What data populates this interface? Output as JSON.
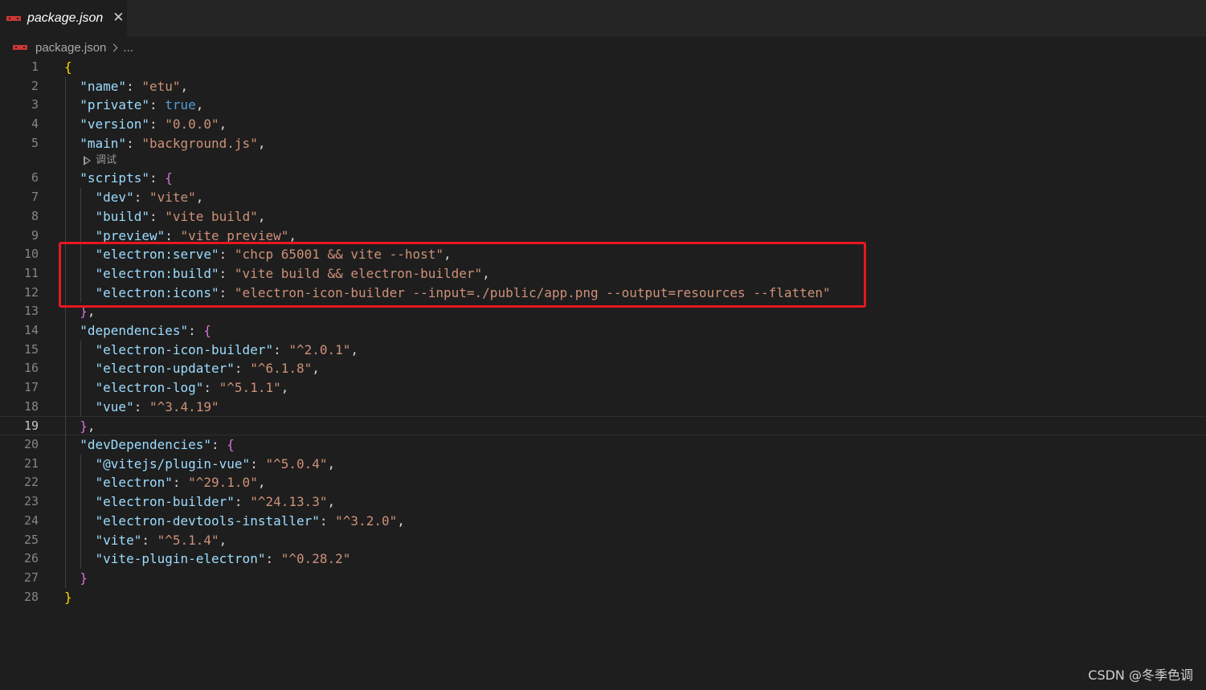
{
  "tab": {
    "title": "package.json",
    "close_glyph": "✕",
    "icon": "npm-icon"
  },
  "breadcrumb": {
    "file": "package.json",
    "more": "..."
  },
  "codelens": {
    "label": "调试",
    "icon": "play-icon"
  },
  "current_line": 19,
  "lines": [
    {
      "n": "1",
      "tokens": [
        [
          "y",
          "{"
        ]
      ]
    },
    {
      "n": "2",
      "tokens": [
        [
          "p",
          "  "
        ],
        [
          "k",
          "\"name\""
        ],
        [
          "p",
          ": "
        ],
        [
          "s",
          "\"etu\""
        ],
        [
          "p",
          ","
        ]
      ]
    },
    {
      "n": "3",
      "tokens": [
        [
          "p",
          "  "
        ],
        [
          "k",
          "\"private\""
        ],
        [
          "p",
          ": "
        ],
        [
          "b",
          "true"
        ],
        [
          "p",
          ","
        ]
      ]
    },
    {
      "n": "4",
      "tokens": [
        [
          "p",
          "  "
        ],
        [
          "k",
          "\"version\""
        ],
        [
          "p",
          ": "
        ],
        [
          "s",
          "\"0.0.0\""
        ],
        [
          "p",
          ","
        ]
      ]
    },
    {
      "n": "5",
      "tokens": [
        [
          "p",
          "  "
        ],
        [
          "k",
          "\"main\""
        ],
        [
          "p",
          ": "
        ],
        [
          "s",
          "\"background.js\""
        ],
        [
          "p",
          ","
        ]
      ]
    },
    {
      "n": "6",
      "tokens": [
        [
          "p",
          "  "
        ],
        [
          "k",
          "\"scripts\""
        ],
        [
          "p",
          ": "
        ],
        [
          "m",
          "{"
        ]
      ]
    },
    {
      "n": "7",
      "tokens": [
        [
          "p",
          "    "
        ],
        [
          "k",
          "\"dev\""
        ],
        [
          "p",
          ": "
        ],
        [
          "s",
          "\"vite\""
        ],
        [
          "p",
          ","
        ]
      ]
    },
    {
      "n": "8",
      "tokens": [
        [
          "p",
          "    "
        ],
        [
          "k",
          "\"build\""
        ],
        [
          "p",
          ": "
        ],
        [
          "s",
          "\"vite build\""
        ],
        [
          "p",
          ","
        ]
      ]
    },
    {
      "n": "9",
      "tokens": [
        [
          "p",
          "    "
        ],
        [
          "k",
          "\"preview\""
        ],
        [
          "p",
          ": "
        ],
        [
          "s",
          "\"vite preview\""
        ],
        [
          "p",
          ","
        ]
      ]
    },
    {
      "n": "10",
      "tokens": [
        [
          "p",
          "    "
        ],
        [
          "k",
          "\"electron:serve\""
        ],
        [
          "p",
          ": "
        ],
        [
          "s",
          "\"chcp 65001 && vite --host\""
        ],
        [
          "p",
          ","
        ]
      ]
    },
    {
      "n": "11",
      "tokens": [
        [
          "p",
          "    "
        ],
        [
          "k",
          "\"electron:build\""
        ],
        [
          "p",
          ": "
        ],
        [
          "s",
          "\"vite build && electron-builder\""
        ],
        [
          "p",
          ","
        ]
      ]
    },
    {
      "n": "12",
      "tokens": [
        [
          "p",
          "    "
        ],
        [
          "k",
          "\"electron:icons\""
        ],
        [
          "p",
          ": "
        ],
        [
          "s",
          "\"electron-icon-builder --input=./public/app.png --output=resources --flatten\""
        ]
      ]
    },
    {
      "n": "13",
      "tokens": [
        [
          "p",
          "  "
        ],
        [
          "m",
          "}"
        ],
        [
          "p",
          ","
        ]
      ]
    },
    {
      "n": "14",
      "tokens": [
        [
          "p",
          "  "
        ],
        [
          "k",
          "\"dependencies\""
        ],
        [
          "p",
          ": "
        ],
        [
          "m",
          "{"
        ]
      ]
    },
    {
      "n": "15",
      "tokens": [
        [
          "p",
          "    "
        ],
        [
          "k",
          "\"electron-icon-builder\""
        ],
        [
          "p",
          ": "
        ],
        [
          "s",
          "\"^2.0.1\""
        ],
        [
          "p",
          ","
        ]
      ]
    },
    {
      "n": "16",
      "tokens": [
        [
          "p",
          "    "
        ],
        [
          "k",
          "\"electron-updater\""
        ],
        [
          "p",
          ": "
        ],
        [
          "s",
          "\"^6.1.8\""
        ],
        [
          "p",
          ","
        ]
      ]
    },
    {
      "n": "17",
      "tokens": [
        [
          "p",
          "    "
        ],
        [
          "k",
          "\"electron-log\""
        ],
        [
          "p",
          ": "
        ],
        [
          "s",
          "\"^5.1.1\""
        ],
        [
          "p",
          ","
        ]
      ]
    },
    {
      "n": "18",
      "tokens": [
        [
          "p",
          "    "
        ],
        [
          "k",
          "\"vue\""
        ],
        [
          "p",
          ": "
        ],
        [
          "s",
          "\"^3.4.19\""
        ]
      ]
    },
    {
      "n": "19",
      "tokens": [
        [
          "p",
          "  "
        ],
        [
          "m",
          "}"
        ],
        [
          "p",
          ","
        ]
      ]
    },
    {
      "n": "20",
      "tokens": [
        [
          "p",
          "  "
        ],
        [
          "k",
          "\"devDependencies\""
        ],
        [
          "p",
          ": "
        ],
        [
          "m",
          "{"
        ]
      ]
    },
    {
      "n": "21",
      "tokens": [
        [
          "p",
          "    "
        ],
        [
          "k",
          "\"@vitejs/plugin-vue\""
        ],
        [
          "p",
          ": "
        ],
        [
          "s",
          "\"^5.0.4\""
        ],
        [
          "p",
          ","
        ]
      ]
    },
    {
      "n": "22",
      "tokens": [
        [
          "p",
          "    "
        ],
        [
          "k",
          "\"electron\""
        ],
        [
          "p",
          ": "
        ],
        [
          "s",
          "\"^29.1.0\""
        ],
        [
          "p",
          ","
        ]
      ]
    },
    {
      "n": "23",
      "tokens": [
        [
          "p",
          "    "
        ],
        [
          "k",
          "\"electron-builder\""
        ],
        [
          "p",
          ": "
        ],
        [
          "s",
          "\"^24.13.3\""
        ],
        [
          "p",
          ","
        ]
      ]
    },
    {
      "n": "24",
      "tokens": [
        [
          "p",
          "    "
        ],
        [
          "k",
          "\"electron-devtools-installer\""
        ],
        [
          "p",
          ": "
        ],
        [
          "s",
          "\"^3.2.0\""
        ],
        [
          "p",
          ","
        ]
      ]
    },
    {
      "n": "25",
      "tokens": [
        [
          "p",
          "    "
        ],
        [
          "k",
          "\"vite\""
        ],
        [
          "p",
          ": "
        ],
        [
          "s",
          "\"^5.1.4\""
        ],
        [
          "p",
          ","
        ]
      ]
    },
    {
      "n": "26",
      "tokens": [
        [
          "p",
          "    "
        ],
        [
          "k",
          "\"vite-plugin-electron\""
        ],
        [
          "p",
          ": "
        ],
        [
          "s",
          "\"^0.28.2\""
        ]
      ]
    },
    {
      "n": "27",
      "tokens": [
        [
          "p",
          "  "
        ],
        [
          "m",
          "}"
        ]
      ]
    },
    {
      "n": "28",
      "tokens": [
        [
          "y",
          "}"
        ]
      ]
    }
  ],
  "watermark": "CSDN @冬季色调",
  "colors": {
    "background": "#1e1e1e",
    "key": "#9cdcfe",
    "string": "#ce9178",
    "boolean": "#569cd6",
    "bracket_outer": "#ffd700",
    "bracket_inner": "#da70d6",
    "highlight_box": "#e8171f"
  }
}
